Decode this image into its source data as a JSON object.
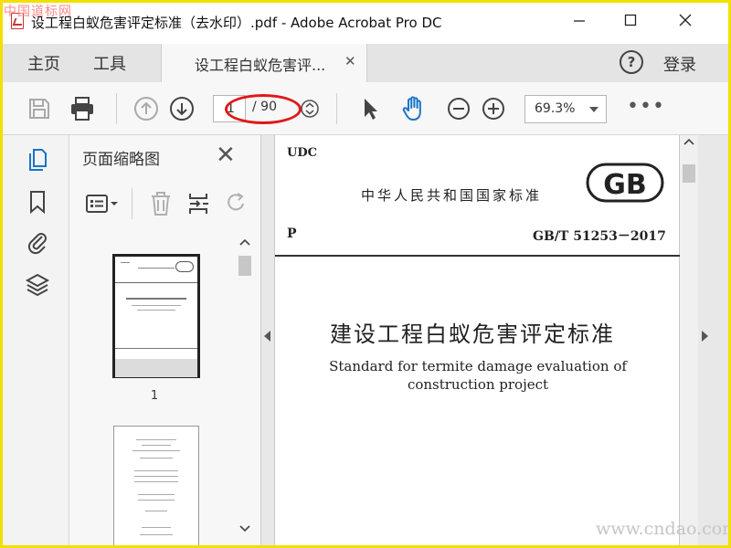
{
  "window": {
    "title": "设工程白蚁危害评定标准（去水印）.pdf - Adobe Acrobat Pro DC",
    "minimize_icon": "minimize-icon",
    "maximize_icon": "maximize-icon",
    "close_icon": "close-icon"
  },
  "watermarks": {
    "top_left": "中国道标网",
    "bottom_right": "www.cndao.com"
  },
  "menubar": {
    "home": "主页",
    "tools": "工具",
    "doc_tab": "设工程白蚁危害评...",
    "help": "?",
    "login": "登录"
  },
  "toolbar": {
    "page_current": "1",
    "page_total": "/ 90",
    "zoom": "69.3%",
    "more": "•••",
    "icons": [
      "save-icon",
      "print-icon",
      "page-up-icon",
      "page-down-icon",
      "page-stepper-icon",
      "select-pointer-icon",
      "hand-tool-icon",
      "zoom-out-icon",
      "zoom-in-icon"
    ]
  },
  "left_rail": {
    "icons": [
      "page-thumbnails-icon",
      "bookmarks-icon",
      "attachments-icon",
      "layers-icon"
    ]
  },
  "thumbnail_panel": {
    "title": "页面缩略图",
    "close": "✕",
    "pages": [
      {
        "number": "1"
      }
    ]
  },
  "document": {
    "udc": "UDC",
    "national_standard": "中华人民共和国国家标准",
    "logo": "GB",
    "classification": "P",
    "code": "GB/T 51253－2017",
    "title_cn": "建设工程白蚁危害评定标准",
    "title_en_line1": "Standard for termite damage evaluation of",
    "title_en_line2": "construction project"
  },
  "colors": {
    "accent_blue": "#1a73c8",
    "annotation_red": "#e01818",
    "frame_yellow": "#f2e000"
  }
}
